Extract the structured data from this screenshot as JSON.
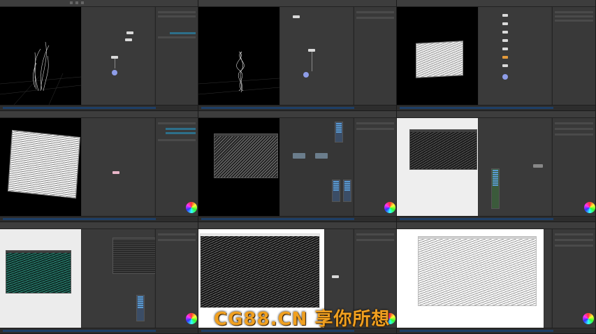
{
  "watermark": {
    "text": "CG88.CN 享你所想",
    "color": "#f0a020"
  },
  "colors": {
    "accent_blue": "#1e3f66",
    "node_blue": "#8e9de8",
    "node_orange": "#e39a3b",
    "param_highlight": "#2d6f8a"
  },
  "panels": [
    {
      "id": "p1",
      "content": "wispy-curves"
    },
    {
      "id": "p2",
      "content": "twisted-spiral"
    },
    {
      "id": "p3",
      "content": "wave-plane"
    },
    {
      "id": "p4",
      "content": "wave-plane-large"
    },
    {
      "id": "p5",
      "content": "compositing-nodes"
    },
    {
      "id": "p6",
      "content": "compositing-preview"
    },
    {
      "id": "p7",
      "content": "teal-render-spreadsheet"
    },
    {
      "id": "p8",
      "content": "dark-wave-render"
    },
    {
      "id": "p9",
      "content": "light-wave-render"
    }
  ],
  "icons": {
    "color_wheel": "color-wheel-icon",
    "node": "node-icon"
  }
}
